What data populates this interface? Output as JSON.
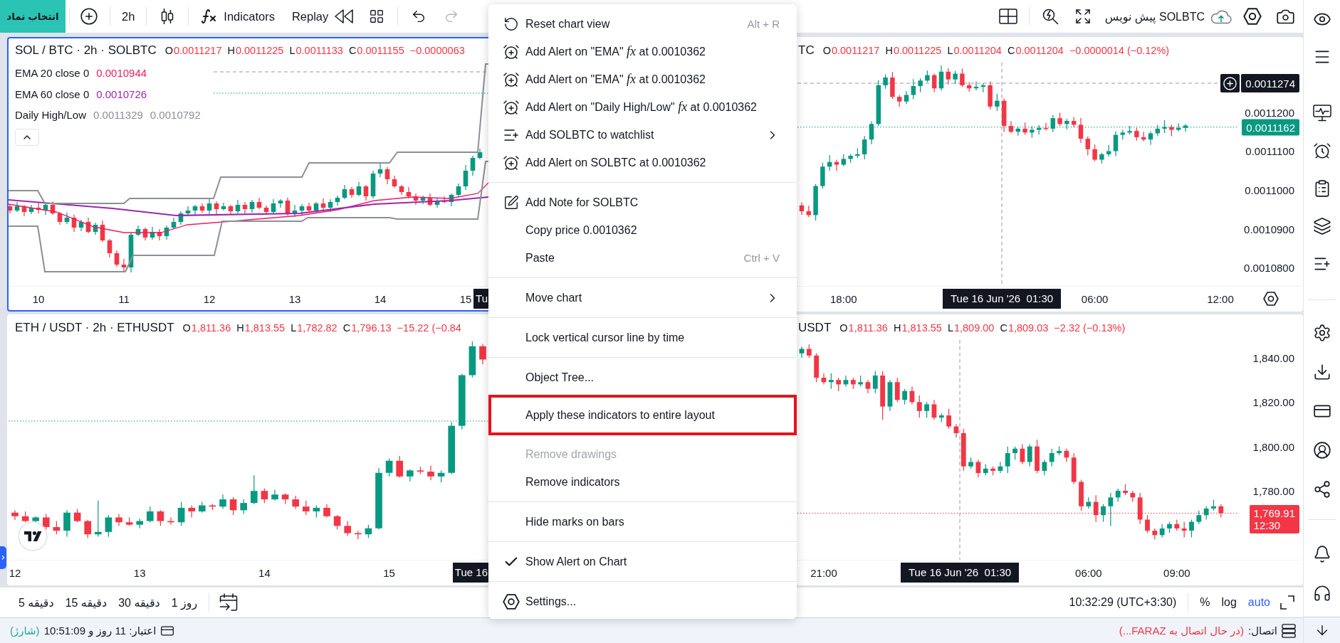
{
  "toolbar": {
    "symbol_button": "انتخاب نماد",
    "interval": "2h",
    "indicators": "Indicators",
    "replay": "Replay",
    "undo": {
      "disabled": false
    },
    "redo": {
      "disabled": true
    },
    "draft": "SOLBTC پیش نویس"
  },
  "charts": [
    {
      "selected": true,
      "rising": true,
      "logo": false,
      "axis_settings": false,
      "title": "SOL / BTC · 2h · SOLBTC",
      "ohlc": [
        {
          "label": "O",
          "value": "0.0011217"
        },
        {
          "label": "H",
          "value": "0.0011225"
        },
        {
          "label": "L",
          "value": "0.0011133"
        },
        {
          "label": "C",
          "value": "0.0011155"
        }
      ],
      "change": "−0.0000063",
      "indicators": [
        {
          "name": "EMA 20 close 0",
          "values": [
            "0.0010944"
          ],
          "color": "#e91e63"
        },
        {
          "name": "EMA 60 close 0",
          "values": [
            "0.0010726"
          ],
          "color": "#9c27b0"
        },
        {
          "name": "Daily High/Low",
          "values": [
            "0.0011329",
            "0.0010792"
          ],
          "color": "#8c8f99"
        }
      ],
      "time_ticks": [
        "10",
        "11",
        "12",
        "13",
        "14",
        "15"
      ],
      "crosshair_time": "Tu"
    },
    {
      "selected": false,
      "rising": true,
      "logo": false,
      "axis_settings": true,
      "title": "TC",
      "ohlc": [
        {
          "label": "O",
          "value": "0.0011217"
        },
        {
          "label": "H",
          "value": "0.0011225"
        },
        {
          "label": "L",
          "value": "0.0011204"
        },
        {
          "label": "C",
          "value": "0.0011204"
        }
      ],
      "change": "−0.0000014 (−0.12%)",
      "crosshair_price": "0.0011274",
      "last_price": {
        "value": "0.0011162"
      },
      "crosshair_time": "Tue 16 Jun '26  01:30",
      "chart_data": {
        "type": "candlestick",
        "ylim": [
          0.0010752294,
          0.001132844
        ],
        "yticks": [
          {
            "value": 0.00112,
            "label": "0.0011200"
          },
          {
            "value": 0.00111,
            "label": "0.0011100"
          },
          {
            "value": 0.0011,
            "label": "0.0011000"
          },
          {
            "value": 0.00109,
            "label": "0.0010900"
          },
          {
            "value": 0.00108,
            "label": "0.0010800"
          }
        ],
        "ref_lines": [
          {
            "axis": "y",
            "value": 0.0011162
          }
        ],
        "categories": [
          null,
          null,
          null,
          null,
          null,
          null,
          "18:00",
          null,
          null,
          null,
          null,
          null,
          null,
          null,
          null,
          null,
          null,
          null,
          null,
          null,
          null,
          null,
          null,
          null,
          null,
          null,
          null,
          null,
          null,
          null,
          null,
          null,
          null,
          null,
          null,
          null,
          null,
          null,
          null,
          null,
          null,
          null,
          "06:00",
          null,
          null,
          null,
          null,
          null,
          null,
          null,
          null,
          null,
          null,
          null,
          null,
          null,
          null,
          null,
          null,
          null,
          "12:00"
        ],
        "ohlc": [
          [
            0.001096,
            0.0010968,
            0.0010936,
            0.0010945
          ],
          [
            0.0010945,
            0.0010959,
            0.001093,
            0.0010935
          ],
          [
            0.0010935,
            0.0011015,
            0.0010921,
            0.001101
          ],
          [
            0.001101,
            0.001107,
            0.0011003,
            0.001106
          ],
          [
            0.001106,
            0.001109,
            0.0011049,
            0.0011072
          ],
          [
            0.0011072,
            0.0011078,
            0.0011049,
            0.0011065
          ],
          [
            0.0011065,
            0.0011092,
            0.0011061,
            0.001108
          ],
          [
            0.001108,
            0.0011092,
            0.001107,
            0.0011088
          ],
          [
            0.0011088,
            0.0011108,
            0.0011082,
            0.0011092
          ],
          [
            0.0011092,
            0.0011139,
            0.0011079,
            0.001113
          ],
          [
            0.001113,
            0.0011177,
            0.0011118,
            0.001117
          ],
          [
            0.001117,
            0.0011283,
            0.0011165,
            0.001127
          ],
          [
            0.001127,
            0.0011298,
            0.0011261,
            0.001129
          ],
          [
            0.001129,
            0.0011304,
            0.0011235,
            0.001124
          ],
          [
            0.001124,
            0.0011245,
            0.0011214,
            0.0011228
          ],
          [
            0.0011228,
            0.0011255,
            0.0011221,
            0.0011245
          ],
          [
            0.0011245,
            0.0011286,
            0.0011234,
            0.0011268
          ],
          [
            0.0011268,
            0.0011288,
            0.0011252,
            0.0011282
          ],
          [
            0.0011282,
            0.0011308,
            0.0011278,
            0.0011296
          ],
          [
            0.0011296,
            0.00113,
            0.0011252,
            0.0011262
          ],
          [
            0.0011262,
            0.0011321,
            0.0011256,
            0.0011305
          ],
          [
            0.0011305,
            0.0011314,
            0.0011272,
            0.0011285
          ],
          [
            0.0011285,
            0.0011307,
            0.0011273,
            0.00113
          ],
          [
            0.00113,
            0.0011313,
            0.0011265,
            0.001127
          ],
          [
            0.001127,
            0.0011278,
            0.0011253,
            0.0011262
          ],
          [
            0.0011262,
            0.001128,
            0.0011257,
            0.0011266
          ],
          [
            0.0011266,
            0.0011275,
            0.0011252,
            0.001127
          ],
          [
            0.001127,
            0.001128,
            0.0011208,
            0.0011215
          ],
          [
            0.0011215,
            0.0011248,
            0.0011204,
            0.001123
          ],
          [
            0.001123,
            0.0011236,
            0.0011149,
            0.0011165
          ],
          [
            0.0011165,
            0.0011177,
            0.0011146,
            0.001115
          ],
          [
            0.001115,
            0.0011162,
            0.001114,
            0.0011158
          ],
          [
            0.0011158,
            0.0011174,
            0.0011142,
            0.0011148
          ],
          [
            0.0011148,
            0.0011164,
            0.0011135,
            0.0011155
          ],
          [
            0.0011155,
            0.0011167,
            0.0011143,
            0.001116
          ],
          [
            0.001116,
            0.0011173,
            0.0011153,
            0.0011158
          ],
          [
            0.0011158,
            0.0011193,
            0.0011149,
            0.0011185
          ],
          [
            0.0011185,
            0.0011199,
            0.0011165,
            0.001117
          ],
          [
            0.001117,
            0.0011183,
            0.0011156,
            0.0011178
          ],
          [
            0.0011178,
            0.0011188,
            0.0011161,
            0.0011168
          ],
          [
            0.0011168,
            0.0011186,
            0.0011121,
            0.0011132
          ],
          [
            0.0011132,
            0.0011138,
            0.0011089,
            0.0011105
          ],
          [
            0.0011105,
            0.0011117,
            0.0011074,
            0.0011078
          ],
          [
            0.0011078,
            0.0011096,
            0.0011068,
            0.0011092
          ],
          [
            0.0011092,
            0.0011116,
            0.0011086,
            0.00111
          ],
          [
            0.00111,
            0.0011151,
            0.0011087,
            0.0011142
          ],
          [
            0.0011142,
            0.0011155,
            0.001113,
            0.0011148
          ],
          [
            0.0011148,
            0.0011165,
            0.0011143,
            0.0011152
          ],
          [
            0.0011152,
            0.001116,
            0.0011127,
            0.0011136
          ],
          [
            0.0011136,
            0.001115,
            0.0011125,
            0.001113
          ],
          [
            0.001113,
            0.0011151,
            0.0011116,
            0.0011146
          ],
          [
            0.0011146,
            0.0011168,
            0.0011139,
            0.0011158
          ],
          [
            0.0011158,
            0.001118,
            0.0011147,
            0.0011162
          ],
          [
            0.0011162,
            0.0011168,
            0.0011139,
            0.0011155
          ],
          [
            0.0011155,
            0.0011172,
            0.0011151,
            0.001116
          ],
          [
            0.001116,
            0.001117,
            0.001115,
            0.0011166
          ],
          null,
          null,
          null,
          null,
          null
        ]
      }
    },
    {
      "selected": false,
      "rising": true,
      "logo": true,
      "axis_settings": false,
      "title": "ETH / USDT · 2h · ETHUSDT",
      "ohlc": [
        {
          "label": "O",
          "value": "1,811.36"
        },
        {
          "label": "H",
          "value": "1,813.55"
        },
        {
          "label": "L",
          "value": "1,782.82"
        },
        {
          "label": "C",
          "value": "1,796.13"
        }
      ],
      "change": "−15.22 (−0.84",
      "time_ticks": [
        "12",
        "13",
        "14",
        "15"
      ],
      "crosshair_time": "Tue 16"
    },
    {
      "selected": false,
      "rising": false,
      "logo": false,
      "axis_settings": false,
      "title": "USDT",
      "ohlc": [
        {
          "label": "O",
          "value": "1,811.36"
        },
        {
          "label": "H",
          "value": "1,813.55"
        },
        {
          "label": "L",
          "value": "1,809.00"
        },
        {
          "label": "C",
          "value": "1,809.03"
        }
      ],
      "change": "−2.32 (−0.13%)",
      "last_price": {
        "value": "1,769.91",
        "countdown": "12:30"
      },
      "crosshair_time": "Tue 16 Jun '26  01:30",
      "chart_data": {
        "type": "candlestick",
        "ylim": [
          1748.877,
          1848.0214
        ],
        "yticks": [
          {
            "value": 1840,
            "label": "1,840.00"
          },
          {
            "value": 1820,
            "label": "1,820.00"
          },
          {
            "value": 1800,
            "label": "1,800.00"
          },
          {
            "value": 1780,
            "label": "1,780.00"
          }
        ],
        "ref_lines": [
          {
            "axis": "y",
            "value": 1769.91
          }
        ],
        "categories": [
          null,
          null,
          null,
          "21:00",
          null,
          null,
          null,
          null,
          null,
          null,
          null,
          null,
          null,
          null,
          null,
          null,
          null,
          null,
          null,
          null,
          null,
          null,
          null,
          null,
          null,
          null,
          null,
          null,
          null,
          null,
          null,
          null,
          null,
          null,
          null,
          null,
          null,
          null,
          null,
          "06:00",
          null,
          null,
          null,
          null,
          null,
          null,
          null,
          null,
          null,
          null,
          null,
          "09:00",
          null,
          null,
          null,
          null,
          null,
          null
        ],
        "ohlc": [
          [
            1842,
            1845,
            1840,
            1844
          ],
          [
            1844,
            1846,
            1840,
            1841
          ],
          [
            1841,
            1842,
            1829,
            1831
          ],
          [
            1831,
            1833,
            1828,
            1829
          ],
          [
            1829,
            1833,
            1826,
            1830
          ],
          [
            1830,
            1831,
            1825,
            1828
          ],
          [
            1828,
            1832,
            1827,
            1830
          ],
          [
            1830,
            1831,
            1826,
            1828
          ],
          [
            1828,
            1832,
            1827,
            1829
          ],
          [
            1829,
            1830,
            1824,
            1826
          ],
          [
            1826,
            1834,
            1824,
            1832
          ],
          [
            1832,
            1834,
            1812,
            1818
          ],
          [
            1818,
            1830,
            1816,
            1829
          ],
          [
            1829,
            1831,
            1820,
            1821
          ],
          [
            1821,
            1826,
            1819,
            1825
          ],
          [
            1825,
            1827,
            1819,
            1820
          ],
          [
            1820,
            1823,
            1813,
            1816
          ],
          [
            1816,
            1820,
            1813,
            1819
          ],
          [
            1819,
            1821,
            1812,
            1813
          ],
          [
            1813,
            1815,
            1811,
            1814
          ],
          [
            1814,
            1817,
            1808,
            1809
          ],
          [
            1809,
            1810,
            1804,
            1806
          ],
          [
            1806,
            1808,
            1789,
            1791
          ],
          [
            1791,
            1795,
            1790,
            1793
          ],
          [
            1793,
            1794,
            1786,
            1788
          ],
          [
            1788,
            1792,
            1787,
            1790
          ],
          [
            1790,
            1791,
            1787,
            1789
          ],
          [
            1789,
            1793,
            1788,
            1791
          ],
          [
            1791,
            1800,
            1788,
            1797
          ],
          [
            1797,
            1800,
            1794,
            1799
          ],
          [
            1799,
            1801,
            1792,
            1793
          ],
          [
            1793,
            1801,
            1791,
            1800
          ],
          [
            1800,
            1803,
            1788,
            1789
          ],
          [
            1789,
            1794,
            1787,
            1793
          ],
          [
            1793,
            1799,
            1791,
            1797
          ],
          [
            1797,
            1800,
            1796,
            1798
          ],
          [
            1798,
            1799,
            1793,
            1795
          ],
          [
            1795,
            1797,
            1783,
            1784
          ],
          [
            1784,
            1785,
            1771,
            1773
          ],
          [
            1773,
            1777,
            1772,
            1775
          ],
          [
            1775,
            1778,
            1766,
            1769
          ],
          [
            1769,
            1774,
            1766,
            1773
          ],
          [
            1773,
            1779,
            1764,
            1777
          ],
          [
            1777,
            1781,
            1775,
            1780
          ],
          [
            1780,
            1783,
            1778,
            1779
          ],
          [
            1779,
            1780,
            1775,
            1777
          ],
          [
            1777,
            1779,
            1765,
            1767
          ],
          [
            1767,
            1769,
            1761,
            1762
          ],
          [
            1762,
            1763,
            1758,
            1760
          ],
          [
            1760,
            1765,
            1759,
            1763
          ],
          [
            1763,
            1766,
            1761,
            1765
          ],
          [
            1765,
            1767,
            1762,
            1763
          ],
          [
            1763,
            1766,
            1759,
            1762
          ],
          [
            1762,
            1767,
            1759,
            1766
          ],
          [
            1766,
            1771,
            1765,
            1769
          ],
          [
            1769,
            1773,
            1767,
            1772
          ],
          [
            1772,
            1776,
            1771,
            1773
          ],
          [
            1773,
            1774,
            1768,
            1769.91
          ]
        ]
      }
    }
  ],
  "context_menu": {
    "sections": [
      {
        "items": [
          {
            "kind": "reset",
            "label": "Reset chart view",
            "shortcut": "Alt + R",
            "disabled": false,
            "outlined": false
          },
          {
            "kind": "alert",
            "label": "Add Alert on \"EMA\" *fx* at 0.0010362",
            "disabled": false,
            "outlined": false
          },
          {
            "kind": "alert",
            "label": "Add Alert on \"EMA\" *fx* at 0.0010362",
            "disabled": false,
            "outlined": false
          },
          {
            "kind": "alert",
            "label": "Add Alert on \"Daily High/Low\" *fx* at 0.0010362",
            "disabled": false,
            "outlined": false
          },
          {
            "kind": "watchlist",
            "label": "Add SOLBTC to watchlist",
            "disabled": false,
            "outlined": false
          },
          {
            "kind": "alert",
            "label": "Add Alert on SOLBTC at 0.0010362",
            "disabled": false,
            "outlined": false
          }
        ]
      },
      {
        "items": [
          {
            "kind": "note",
            "label": "Add Note for SOLBTC",
            "disabled": false,
            "outlined": false
          },
          {
            "kind": "plain",
            "label": "Copy price 0.0010362",
            "disabled": false,
            "outlined": false
          },
          {
            "kind": "plain",
            "label": "Paste",
            "shortcut": "Ctrl + V",
            "disabled": false,
            "outlined": false
          }
        ]
      },
      {
        "items": [
          {
            "kind": "submenu",
            "label": "Move chart",
            "disabled": false,
            "outlined": false
          }
        ]
      },
      {
        "items": [
          {
            "kind": "toggle",
            "label": "Lock vertical cursor line by time",
            "checked": false,
            "disabled": false
          }
        ]
      },
      {
        "items": [
          {
            "kind": "plain",
            "label": "Object Tree...",
            "disabled": false,
            "outlined": false
          },
          {
            "kind": "plain",
            "label": "Apply these indicators to entire layout",
            "disabled": false,
            "outlined": true
          },
          {
            "kind": "plain",
            "label": "Remove drawings",
            "disabled": true,
            "outlined": false
          },
          {
            "kind": "plain",
            "label": "Remove indicators",
            "disabled": false,
            "outlined": false
          }
        ]
      },
      {
        "items": [
          {
            "kind": "plain",
            "label": "Hide marks on bars",
            "disabled": false,
            "outlined": false
          }
        ]
      },
      {
        "items": [
          {
            "kind": "toggle",
            "label": "Show Alert on Chart",
            "checked": true,
            "disabled": false
          }
        ]
      },
      {
        "items": [
          {
            "kind": "settings",
            "label": "Settings...",
            "disabled": false,
            "outlined": false
          }
        ]
      }
    ]
  },
  "bottom_toolbar": {
    "intervals": [
      "روز 1",
      "دقیقه 30",
      "دقیقه 15",
      "دقیقه 5"
    ],
    "clock": "10:32:29 (UTC+3:30)",
    "scale_buttons": [
      {
        "label": "%",
        "on": false
      },
      {
        "label": "log",
        "on": false
      },
      {
        "label": "auto",
        "on": true
      }
    ]
  },
  "status_bar": {
    "credit": "اعتبار: 11 روز و 10:51:09",
    "charge": "(شارژ)",
    "connection_label": "اتصال:",
    "connection_status": "(در حال اتصال به FARAZ...)"
  }
}
